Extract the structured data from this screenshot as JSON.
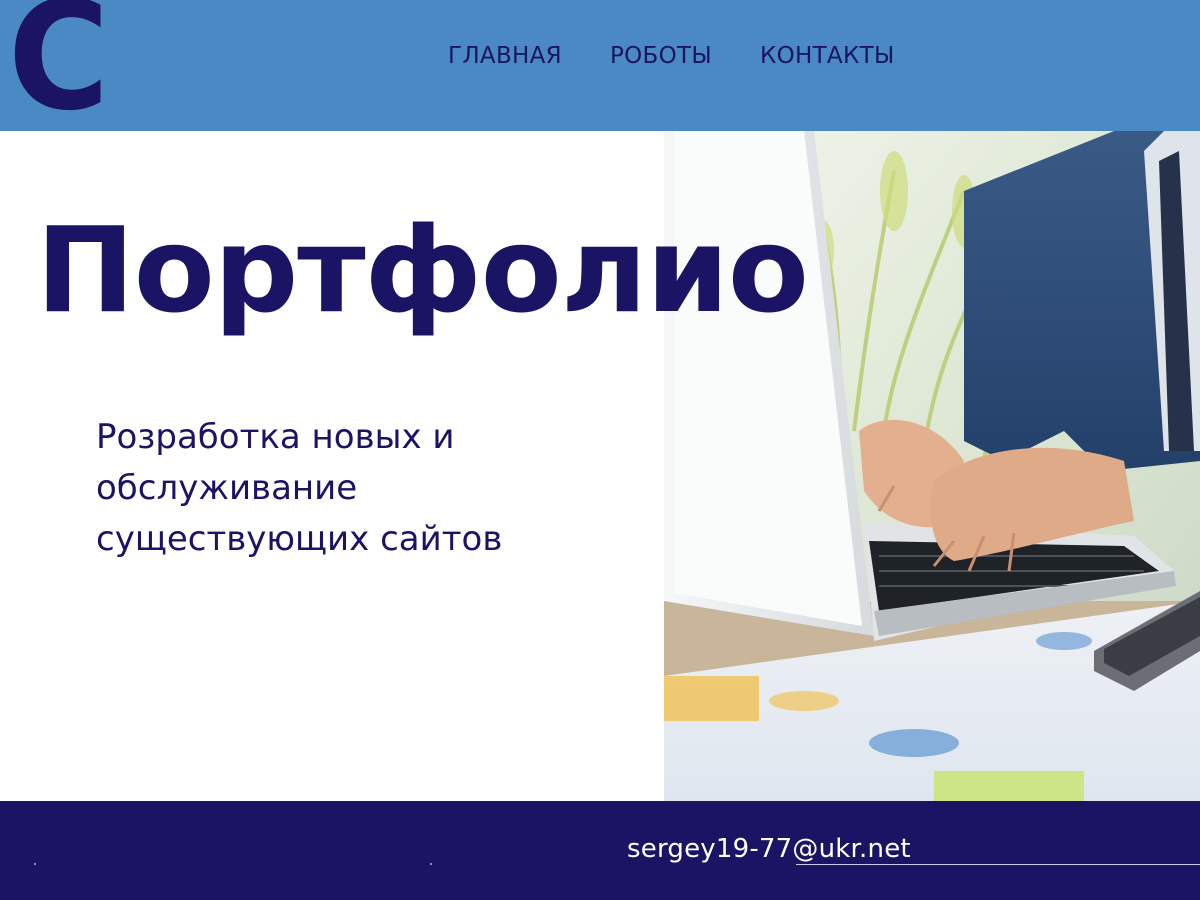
{
  "header": {
    "logo_letter": "С",
    "nav": [
      {
        "label": "ГЛАВНАЯ"
      },
      {
        "label": "РОБОТЫ"
      },
      {
        "label": "КОНТАКТЫ"
      }
    ]
  },
  "hero": {
    "title": "Портфолио",
    "subtitle": "Розработка новых и обслуживание существующих сайтов",
    "photo": "businessman-typing-on-laptop"
  },
  "footer": {
    "email": "sergey19-77@ukr.net"
  },
  "colors": {
    "header_bg": "#4a89c4",
    "brand_dark": "#1b1464",
    "footer_bg": "#1b1464",
    "page_bg": "#ffffff"
  }
}
